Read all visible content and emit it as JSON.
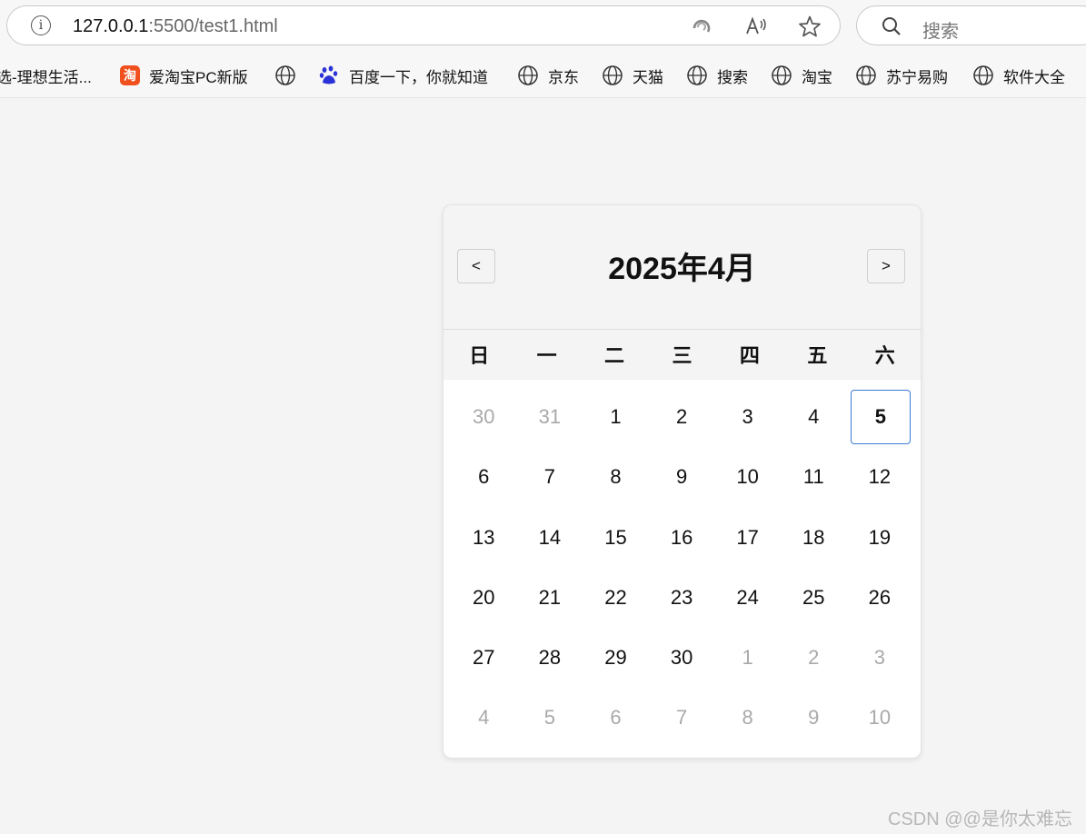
{
  "browser": {
    "url_host": "127.0.0.1",
    "url_rest": ":5500/test1.html",
    "search_placeholder": "搜索",
    "bookmarks": [
      "选-理想生活...",
      "爱淘宝PC新版",
      "百度一下，你就知道",
      "京东",
      "天猫",
      "搜索",
      "淘宝",
      "苏宁易购",
      "软件大全"
    ]
  },
  "calendar": {
    "title": "2025年4月",
    "prev_label": "<",
    "next_label": ">",
    "weekdays": [
      "日",
      "一",
      "二",
      "三",
      "四",
      "五",
      "六"
    ],
    "days": [
      {
        "label": "30",
        "muted": true
      },
      {
        "label": "31",
        "muted": true
      },
      {
        "label": "1"
      },
      {
        "label": "2"
      },
      {
        "label": "3"
      },
      {
        "label": "4"
      },
      {
        "label": "5",
        "today": true
      },
      {
        "label": "6"
      },
      {
        "label": "7"
      },
      {
        "label": "8"
      },
      {
        "label": "9"
      },
      {
        "label": "10"
      },
      {
        "label": "11"
      },
      {
        "label": "12"
      },
      {
        "label": "13"
      },
      {
        "label": "14"
      },
      {
        "label": "15"
      },
      {
        "label": "16"
      },
      {
        "label": "17"
      },
      {
        "label": "18"
      },
      {
        "label": "19"
      },
      {
        "label": "20"
      },
      {
        "label": "21"
      },
      {
        "label": "22"
      },
      {
        "label": "23"
      },
      {
        "label": "24"
      },
      {
        "label": "25"
      },
      {
        "label": "26"
      },
      {
        "label": "27"
      },
      {
        "label": "28"
      },
      {
        "label": "29"
      },
      {
        "label": "30"
      },
      {
        "label": "1",
        "muted": true
      },
      {
        "label": "2",
        "muted": true
      },
      {
        "label": "3",
        "muted": true
      },
      {
        "label": "4",
        "muted": true
      },
      {
        "label": "5",
        "muted": true
      },
      {
        "label": "6",
        "muted": true
      },
      {
        "label": "7",
        "muted": true
      },
      {
        "label": "8",
        "muted": true
      },
      {
        "label": "9",
        "muted": true
      },
      {
        "label": "10",
        "muted": true
      }
    ]
  },
  "watermark": "CSDN @@是你太难忘",
  "colors": {
    "today_border": "#3a7bd5",
    "muted_day": "#a9a9a9",
    "page_bg": "#f4f4f4"
  }
}
